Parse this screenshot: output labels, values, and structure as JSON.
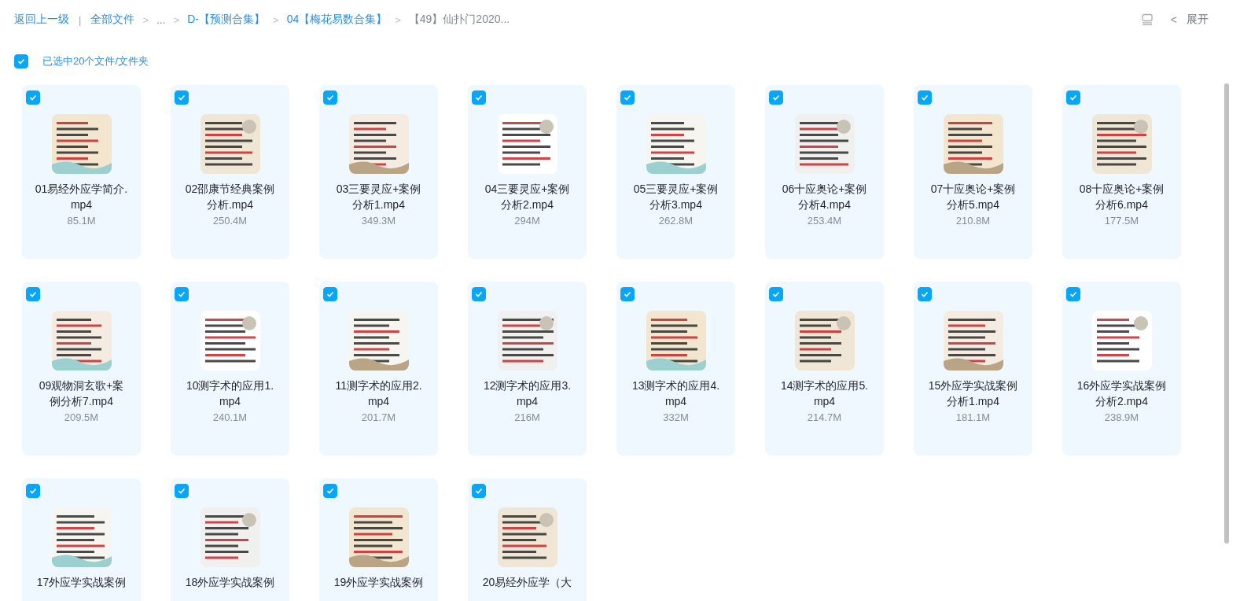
{
  "breadcrumbs": [
    {
      "label": "返回上一级",
      "kind": "back"
    },
    {
      "label": "全部文件",
      "kind": "link",
      "sep": "|"
    },
    {
      "label": "...",
      "kind": "ellipsis",
      "sep": ">"
    },
    {
      "label": "D-【预测合集】",
      "kind": "link",
      "sep": ">"
    },
    {
      "label": "04【梅花易数合集】",
      "kind": "link",
      "sep": ">"
    },
    {
      "label": "【49】仙扑门2020...",
      "kind": "current",
      "sep": ">"
    }
  ],
  "toolbar": {
    "expand_label": "展开",
    "expand_arrow": "<"
  },
  "selection": {
    "checked": true,
    "label": "已选中20个文件/文件夹"
  },
  "files": [
    {
      "name": "01易经外应学简介.mp4",
      "size": "85.1M",
      "checked": true
    },
    {
      "name": "02邵康节经典案例分析.mp4",
      "size": "250.4M",
      "checked": true
    },
    {
      "name": "03三要灵应+案例分析1.mp4",
      "size": "349.3M",
      "checked": true
    },
    {
      "name": "04三要灵应+案例分析2.mp4",
      "size": "294M",
      "checked": true
    },
    {
      "name": "05三要灵应+案例分析3.mp4",
      "size": "262.8M",
      "checked": true
    },
    {
      "name": "06十应奥论+案例分析4.mp4",
      "size": "253.4M",
      "checked": true
    },
    {
      "name": "07十应奥论+案例分析5.mp4",
      "size": "210.8M",
      "checked": true
    },
    {
      "name": "08十应奥论+案例分析6.mp4",
      "size": "177.5M",
      "checked": true
    },
    {
      "name": "09观物洞玄歌+案例分析7.mp4",
      "size": "209.5M",
      "checked": true
    },
    {
      "name": "10测字术的应用1.mp4",
      "size": "240.1M",
      "checked": true
    },
    {
      "name": "11测字术的应用2.mp4",
      "size": "201.7M",
      "checked": true
    },
    {
      "name": "12测字术的应用3.mp4",
      "size": "216M",
      "checked": true
    },
    {
      "name": "13测字术的应用4.mp4",
      "size": "332M",
      "checked": true
    },
    {
      "name": "14测字术的应用5.mp4",
      "size": "214.7M",
      "checked": true
    },
    {
      "name": "15外应学实战案例分析1.mp4",
      "size": "181.1M",
      "checked": true
    },
    {
      "name": "16外应学实战案例分析2.mp4",
      "size": "238.9M",
      "checked": true
    },
    {
      "name": "17外应学实战案例",
      "checked": true
    },
    {
      "name": "18外应学实战案例",
      "checked": true
    },
    {
      "name": "19外应学实战案例",
      "checked": true
    },
    {
      "name": "20易经外应学（大",
      "checked": true
    }
  ]
}
